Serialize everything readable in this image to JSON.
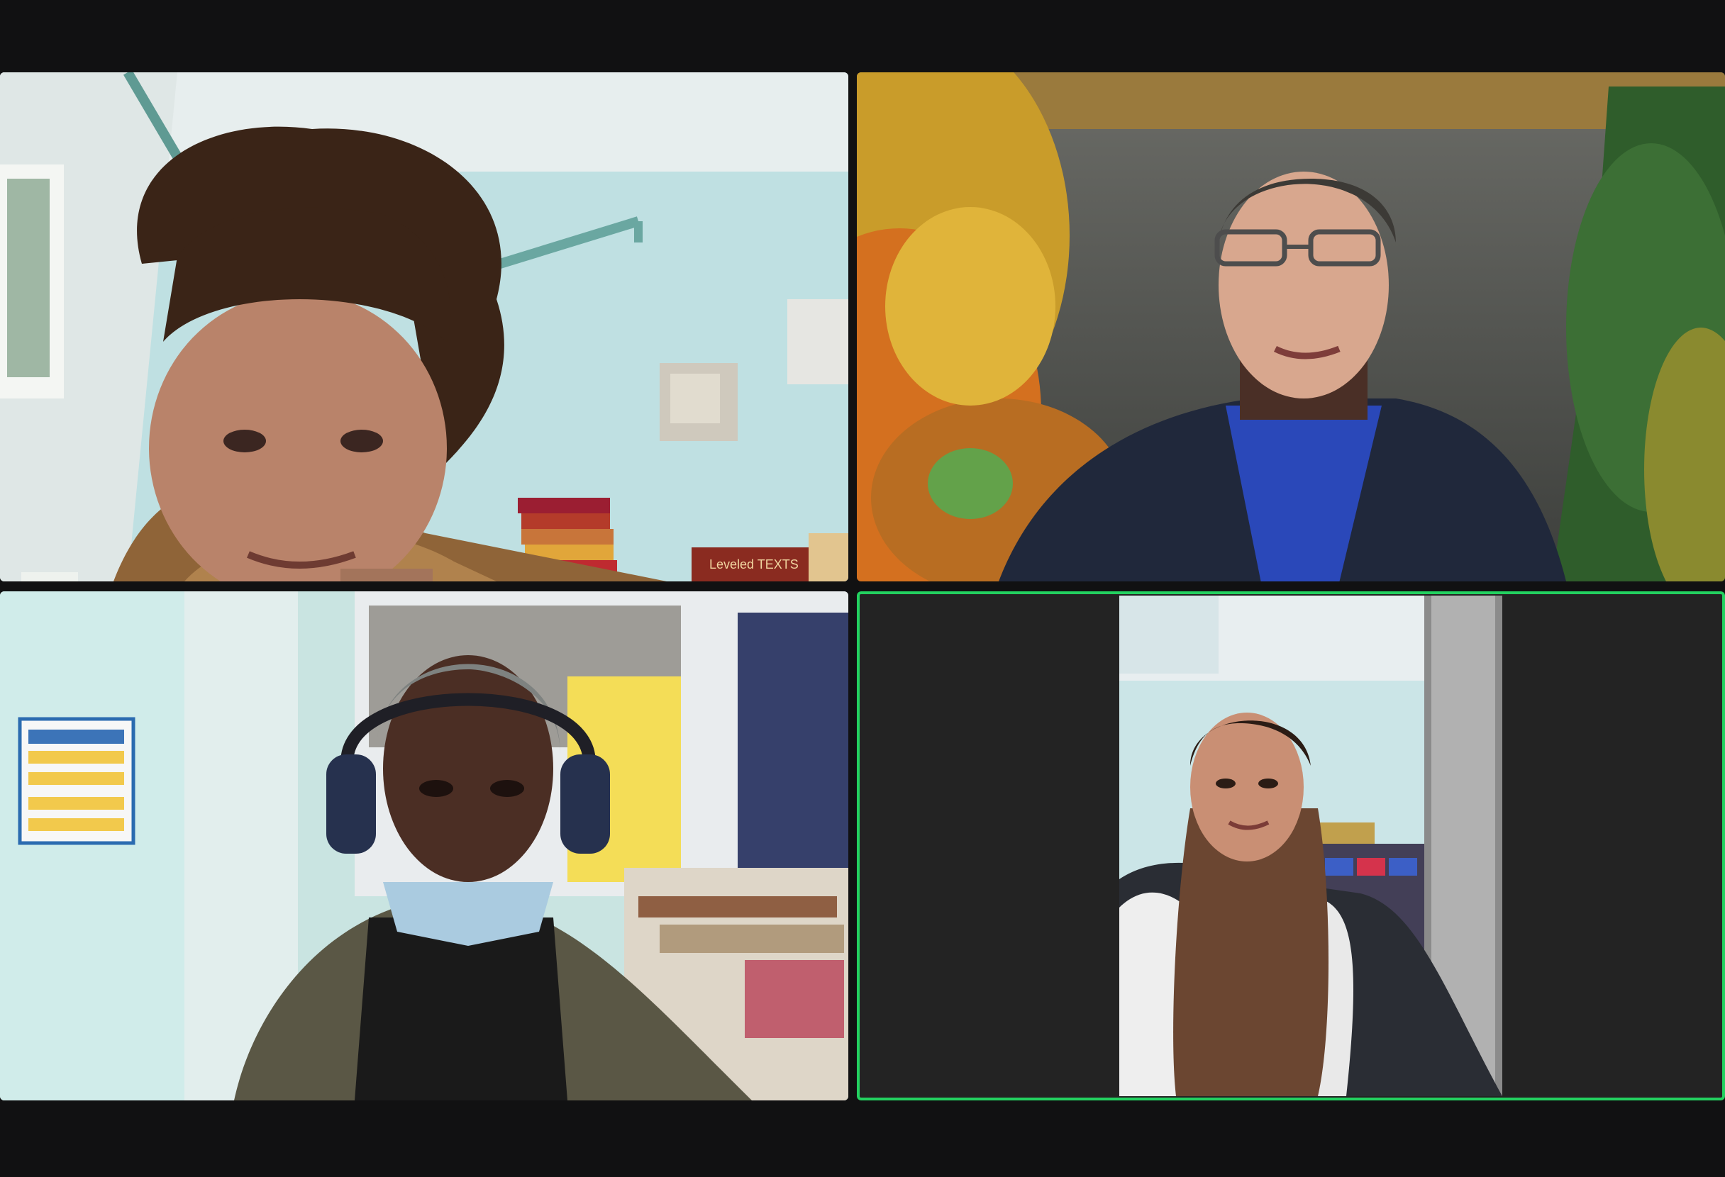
{
  "meeting": {
    "view": "gallery",
    "participants": [
      {
        "id": "p1",
        "name": "",
        "video": "on",
        "active_speaker": false
      },
      {
        "id": "p2",
        "name": "",
        "video": "on",
        "active_speaker": false
      },
      {
        "id": "p3",
        "name": "",
        "video": "on",
        "active_speaker": false
      },
      {
        "id": "p4",
        "name": "",
        "video": "on",
        "active_speaker": true
      }
    ]
  },
  "colors": {
    "background": "#111112",
    "tile_background": "#232323",
    "active_speaker_border": "#23d160"
  },
  "book_box_label": "Leveled TEXTS"
}
